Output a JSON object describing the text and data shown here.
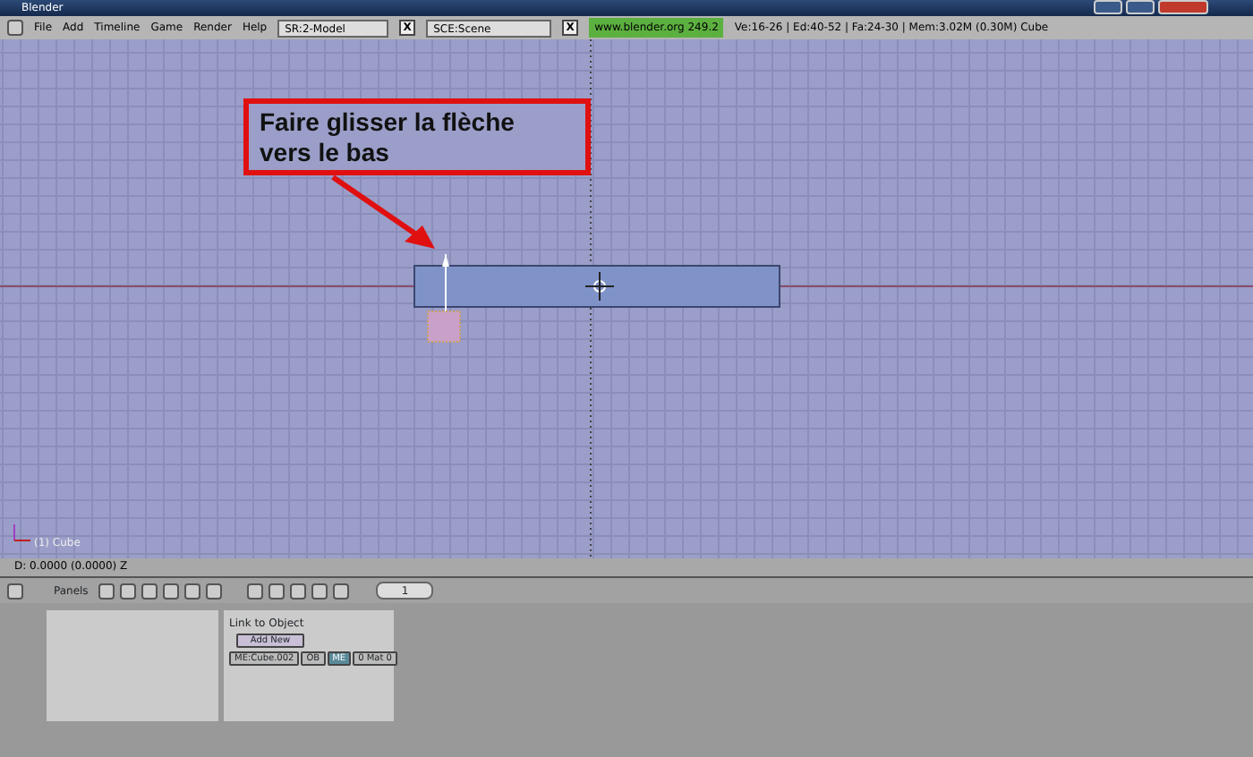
{
  "window": {
    "title": "Blender"
  },
  "menu": {
    "items": [
      "File",
      "Add",
      "Timeline",
      "Game",
      "Render",
      "Help"
    ],
    "screen": "SR:2-Model",
    "screen_delete": "X",
    "scene": "SCE:Scene",
    "scene_delete": "X",
    "version": "www.blender.org 249.2",
    "stats": "Ve:16-26 | Ed:40-52 | Fa:24-30 | Mem:3.02M (0.30M) Cube"
  },
  "viewport": {
    "callout": "Faire glisser la flèche vers le bas",
    "object_label": "(1) Cube"
  },
  "status": "D: 0.0000 (0.0000) Z",
  "buttons_header": {
    "label": "Panels",
    "frame": "1"
  },
  "link_panel": {
    "title": "Link to Object",
    "add_button": "Add New",
    "mesh": "ME:Cube.002",
    "ob": "OB",
    "me": "ME",
    "mat": "0 Mat 0"
  }
}
